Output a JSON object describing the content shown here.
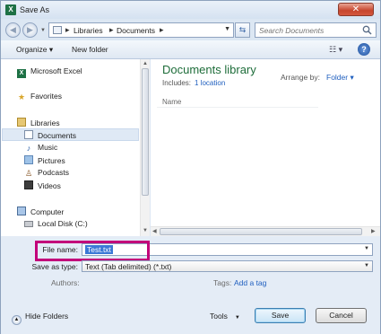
{
  "window": {
    "title": "Save As",
    "app_icon": "X"
  },
  "address": {
    "crumbs": [
      "Libraries",
      "Documents"
    ],
    "search_placeholder": "Search Documents"
  },
  "toolbar": {
    "organize": "Organize ▾",
    "new_folder": "New folder"
  },
  "nav": {
    "items": [
      {
        "label": "Microsoft Excel",
        "icon": "excel-icon"
      },
      {
        "label": "Favorites",
        "icon": "star-icon"
      },
      {
        "label": "Libraries",
        "icon": "libraries-icon"
      },
      {
        "label": "Documents",
        "icon": "documents-icon",
        "selected": true
      },
      {
        "label": "Music",
        "icon": "music-icon"
      },
      {
        "label": "Pictures",
        "icon": "pictures-icon"
      },
      {
        "label": "Podcasts",
        "icon": "podcasts-icon"
      },
      {
        "label": "Videos",
        "icon": "videos-icon"
      },
      {
        "label": "Computer",
        "icon": "computer-icon"
      },
      {
        "label": "Local Disk (C:)",
        "icon": "disk-icon"
      }
    ]
  },
  "content": {
    "title": "Documents library",
    "includes_label": "Includes:",
    "includes_link": "1 location",
    "arrange_label": "Arrange by:",
    "arrange_value": "Folder ▾",
    "column_name": "Name"
  },
  "form": {
    "file_name_label": "File name:",
    "file_name_value": "Test.txt",
    "save_type_label": "Save as type:",
    "save_type_value": "Text (Tab delimited) (*.txt)",
    "authors_label": "Authors:",
    "tags_label": "Tags:",
    "tags_link": "Add a tag"
  },
  "footer": {
    "hide_folders": "Hide Folders",
    "tools": "Tools",
    "save": "Save",
    "cancel": "Cancel"
  },
  "colors": {
    "highlight_border": "#c2007a",
    "library_title": "#1e6d3a",
    "link": "#1f5fbf"
  }
}
